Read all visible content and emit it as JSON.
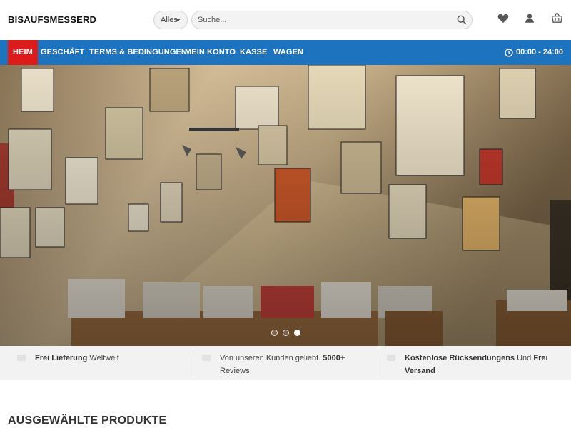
{
  "header": {
    "logo": "BISAUFSMESSERD",
    "category_select": "Alles",
    "search_placeholder": "Suche..."
  },
  "icons": [
    "heart-icon",
    "user-icon",
    "cart-icon",
    "search-icon",
    "clock-icon",
    "chevron-down-icon"
  ],
  "nav": {
    "items": [
      "HEIM",
      "GESCHÄFT",
      "TERMS & BEDINGUNGEN",
      "MEIN KONTO",
      "KASSE",
      "WAGEN"
    ],
    "hours": "00:00 - 24:00",
    "active_color": "#dd1b1b",
    "bar_color": "#1e73be"
  },
  "slider": {
    "slide_count": 3,
    "active_slide": 3
  },
  "features": [
    {
      "bold": "Frei Lieferung",
      "text": " Weltweit"
    },
    {
      "text": "Von unseren Kunden geliebt. ",
      "bold": "5000+",
      "text2": " Reviews"
    },
    {
      "bold": "Kostenlose Rücksendungens",
      "text": " Und ",
      "bold2": "Frei Versand"
    }
  ],
  "section_title": "AUSGEWÄHLTE PRODUKTE"
}
